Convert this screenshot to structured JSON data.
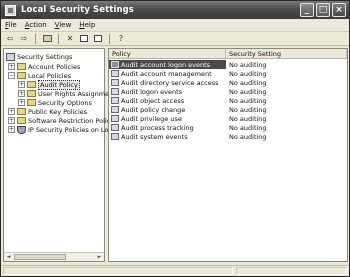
{
  "window": {
    "title": "Local Security Settings",
    "icon": "security-settings-icon",
    "buttons": {
      "minimize": "_",
      "maximize": "□",
      "close": "×"
    }
  },
  "menu": [
    {
      "label": "File",
      "underline": "F"
    },
    {
      "label": "Action",
      "underline": "A"
    },
    {
      "label": "View",
      "underline": "V"
    },
    {
      "label": "Help",
      "underline": "H"
    }
  ],
  "toolbar": {
    "back": "⇦",
    "forward": "⇨",
    "icons": [
      "back-arrow-icon",
      "forward-arrow-icon",
      "up-folder-icon",
      "delete-icon",
      "properties-icon",
      "export-list-icon",
      "help-icon"
    ],
    "delete": "✕",
    "help": "?"
  },
  "tree": {
    "root": "Security Settings",
    "items": [
      {
        "label": "Account Policies",
        "expander": "+"
      },
      {
        "label": "Local Policies",
        "expander": "−"
      },
      {
        "label": "Audit Policy",
        "expander": "+"
      },
      {
        "label": "User Rights Assignment",
        "expander": "+"
      },
      {
        "label": "Security Options",
        "expander": "+"
      },
      {
        "label": "Public Key Policies",
        "expander": "+"
      },
      {
        "label": "Software Restriction Policies",
        "expander": "+"
      },
      {
        "label": "IP Security Policies on Local Computer",
        "expander": "+"
      }
    ],
    "scroll_left": "◄",
    "scroll_right": "►"
  },
  "list": {
    "columns": [
      "Policy",
      "Security Setting"
    ],
    "rows": [
      {
        "policy": "Audit account logon events",
        "setting": "No auditing"
      },
      {
        "policy": "Audit account management",
        "setting": "No auditing"
      },
      {
        "policy": "Audit directory service access",
        "setting": "No auditing"
      },
      {
        "policy": "Audit logon events",
        "setting": "No auditing"
      },
      {
        "policy": "Audit object access",
        "setting": "No auditing"
      },
      {
        "policy": "Audit policy change",
        "setting": "No auditing"
      },
      {
        "policy": "Audit privilege use",
        "setting": "No auditing"
      },
      {
        "policy": "Audit process tracking",
        "setting": "No auditing"
      },
      {
        "policy": "Audit system events",
        "setting": "No auditing"
      }
    ],
    "selected_index": 0
  }
}
